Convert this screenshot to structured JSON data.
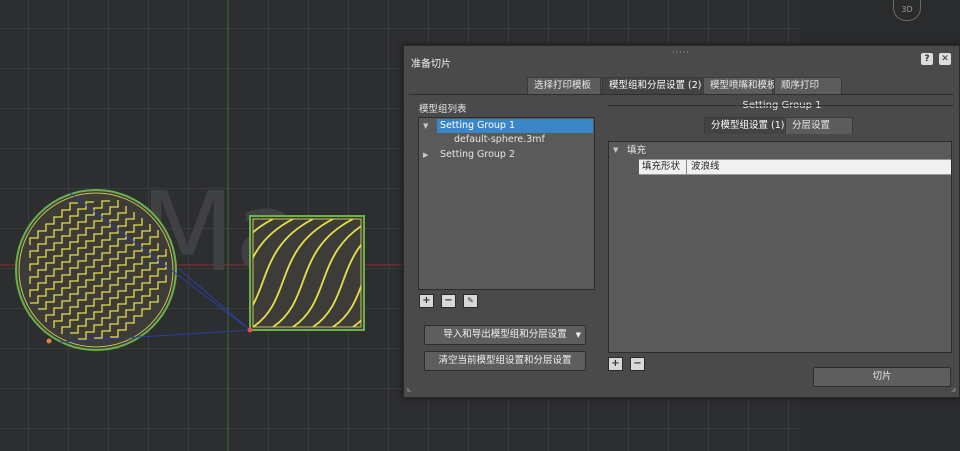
{
  "viewport": {
    "watermark": "Ma",
    "orientation_cube_label": "3D"
  },
  "dialog": {
    "title": "准备切片",
    "help_label": "?",
    "close_label": "✕",
    "tabs": [
      {
        "label": "选择打印模板",
        "active": false
      },
      {
        "label": "模型组和分层设置 (2)",
        "active": true
      },
      {
        "label": "模型喷嘴和模板",
        "active": false
      },
      {
        "label": "顺序打印",
        "active": false
      }
    ],
    "group_list": {
      "label": "模型组列表",
      "items": [
        {
          "label": "Setting Group 1",
          "expanded": true,
          "selected": true
        },
        {
          "label": "default-sphere.3mf",
          "child": true
        },
        {
          "label": "Setting Group 2",
          "expanded": false
        }
      ],
      "add_icon": "plus-icon",
      "remove_icon": "minus-icon",
      "edit_icon": "pencil-icon",
      "import_export_label": "导入和导出模型组和分层设置",
      "clear_label": "清空当前模型组设置和分层设置"
    },
    "setting_group": {
      "title": "Setting Group 1",
      "sub_tabs": [
        {
          "label": "分模型组设置 (1)",
          "active": true
        },
        {
          "label": "分层设置",
          "active": false
        }
      ],
      "category": "填充",
      "properties": [
        {
          "name": "填充形状",
          "value": "波浪线"
        }
      ]
    },
    "slice_label": "切片"
  },
  "colors": {
    "accent": "#3b86c8",
    "infill": "#e6e04a",
    "outline": "#6ab04c"
  }
}
